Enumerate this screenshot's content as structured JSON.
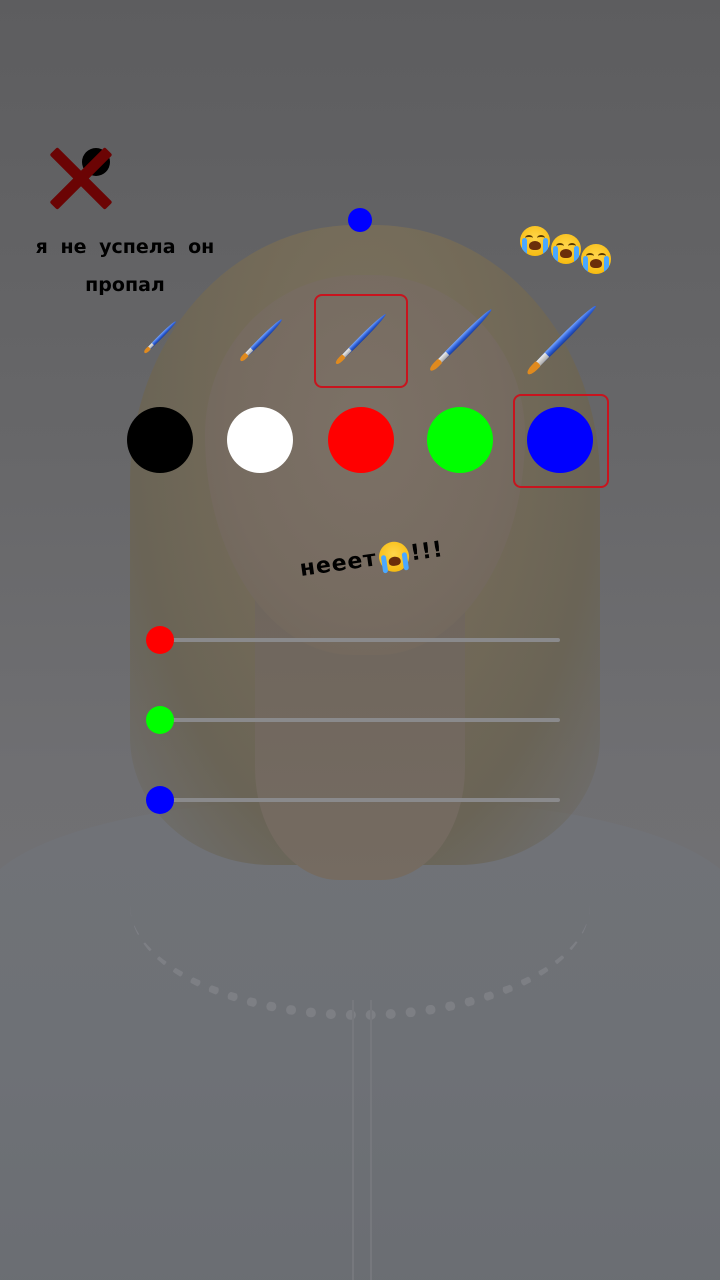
{
  "overlay": {
    "caption": "я не успела он пропал",
    "exclaim_word": "нееет",
    "exclaim_tail": "!!!",
    "cry_emoji_count": 3
  },
  "close_button": {
    "icon": "x-icon",
    "color": "#6b0404",
    "dot_color": "#000000"
  },
  "current_color_dot": "#0000ff",
  "brush_sizes": {
    "count": 5,
    "selected_index": 2
  },
  "palette": {
    "colors": [
      "#000000",
      "#ffffff",
      "#ff0000",
      "#00ff00",
      "#0000ff"
    ],
    "names": [
      "black",
      "white",
      "red",
      "green",
      "blue"
    ],
    "selected_index": 4,
    "selection_border_color": "#c8141e"
  },
  "rgb_sliders": [
    {
      "channel": "red",
      "color": "#ff0000",
      "value": 0
    },
    {
      "channel": "green",
      "color": "#00ff00",
      "value": 0
    },
    {
      "channel": "blue",
      "color": "#0000ff",
      "value": 0
    }
  ]
}
